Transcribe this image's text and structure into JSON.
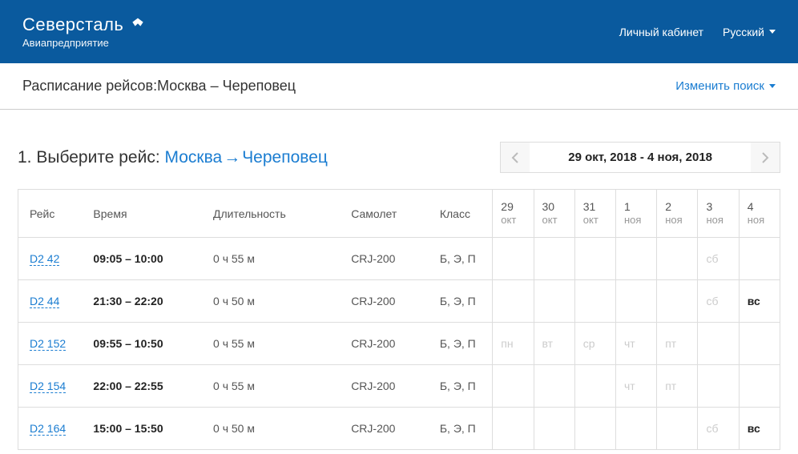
{
  "header": {
    "brand": "Северсталь",
    "brand_sub": "Авиапредприятие",
    "personal": "Личный кабинет",
    "lang": "Русский"
  },
  "subheader": {
    "prefix": "Расписание рейсов:",
    "from": "Москва",
    "sep": "–",
    "to": "Череповец",
    "modify": "Изменить поиск"
  },
  "step": {
    "label": "1. Выберите рейс: ",
    "from": "Москва",
    "to": "Череповец"
  },
  "date_range": "29 окт, 2018 - 4 ноя, 2018",
  "columns": {
    "flight": "Рейс",
    "time": "Время",
    "duration": "Длительность",
    "plane": "Самолет",
    "class": "Класс"
  },
  "days": [
    {
      "num": "29",
      "mon": "окт"
    },
    {
      "num": "30",
      "mon": "окт"
    },
    {
      "num": "31",
      "mon": "окт"
    },
    {
      "num": "1",
      "mon": "ноя"
    },
    {
      "num": "2",
      "mon": "ноя"
    },
    {
      "num": "3",
      "mon": "ноя"
    },
    {
      "num": "4",
      "mon": "ноя"
    }
  ],
  "flights": [
    {
      "code": "D2 42",
      "time": "09:05 – 10:00",
      "dur": "0 ч 55 м",
      "plane": "CRJ-200",
      "cls": "Б, Э, П",
      "cells": [
        "",
        "",
        "",
        "",
        "",
        "сб",
        ""
      ],
      "avail": [
        false,
        false,
        false,
        false,
        false,
        false,
        false
      ]
    },
    {
      "code": "D2 44",
      "time": "21:30 – 22:20",
      "dur": "0 ч 50 м",
      "plane": "CRJ-200",
      "cls": "Б, Э, П",
      "cells": [
        "",
        "",
        "",
        "",
        "",
        "сб",
        "вс"
      ],
      "avail": [
        false,
        false,
        false,
        false,
        false,
        false,
        true
      ]
    },
    {
      "code": "D2 152",
      "time": "09:55 – 10:50",
      "dur": "0 ч 55 м",
      "plane": "CRJ-200",
      "cls": "Б, Э, П",
      "cells": [
        "пн",
        "вт",
        "ср",
        "чт",
        "пт",
        "",
        ""
      ],
      "avail": [
        false,
        false,
        false,
        false,
        false,
        false,
        false
      ]
    },
    {
      "code": "D2 154",
      "time": "22:00 – 22:55",
      "dur": "0 ч 55 м",
      "plane": "CRJ-200",
      "cls": "Б, Э, П",
      "cells": [
        "",
        "",
        "",
        "чт",
        "пт",
        "",
        ""
      ],
      "avail": [
        false,
        false,
        false,
        false,
        false,
        false,
        false
      ]
    },
    {
      "code": "D2 164",
      "time": "15:00 – 15:50",
      "dur": "0 ч 50 м",
      "plane": "CRJ-200",
      "cls": "Б, Э, П",
      "cells": [
        "",
        "",
        "",
        "",
        "",
        "сб",
        "вс"
      ],
      "avail": [
        false,
        false,
        false,
        false,
        false,
        false,
        true
      ]
    }
  ]
}
